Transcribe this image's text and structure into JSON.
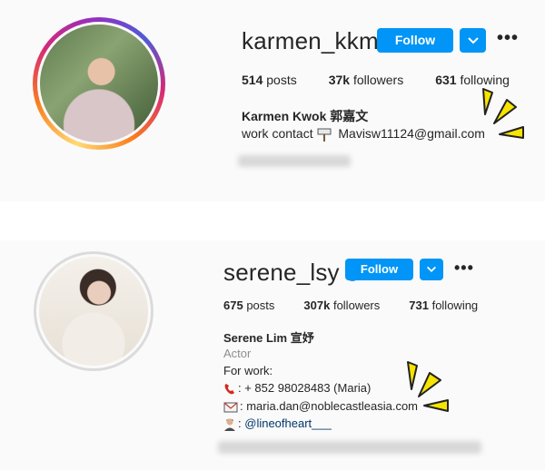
{
  "profiles": [
    {
      "username": "karmen_kkm",
      "follow_label": "Follow",
      "posts_count": "514",
      "posts_label": "posts",
      "followers_count": "37k",
      "followers_label": "followers",
      "following_count": "631",
      "following_label": "following",
      "full_name": "Karmen Kwok 郭嘉文",
      "bio_lines": [
        "work contact",
        "Mavisw11124@gmail.com"
      ],
      "verified": false
    },
    {
      "username": "serene_lsy",
      "follow_label": "Follow",
      "posts_count": "675",
      "posts_label": "posts",
      "followers_count": "307k",
      "followers_label": "followers",
      "following_count": "731",
      "following_label": "following",
      "full_name": "Serene Lim 宣妤",
      "category": "Actor",
      "bio_lines": [
        "For work:",
        ": + 852 98028483 (Maria)",
        ": maria.dan@noblecastleasia.com",
        ":",
        "@lineofheart___"
      ],
      "verified": true
    }
  ],
  "icons": {
    "verified": "verified-badge-icon",
    "dropdown": "chevron-down-icon",
    "more": "more-options-icon",
    "sign": "signpost-icon",
    "phone": "telephone-icon",
    "email": "envelope-icon",
    "person": "person-icon"
  },
  "colors": {
    "follow_button": "#0095f6",
    "highlight_spark": "#f7e400",
    "link": "#00376b"
  }
}
